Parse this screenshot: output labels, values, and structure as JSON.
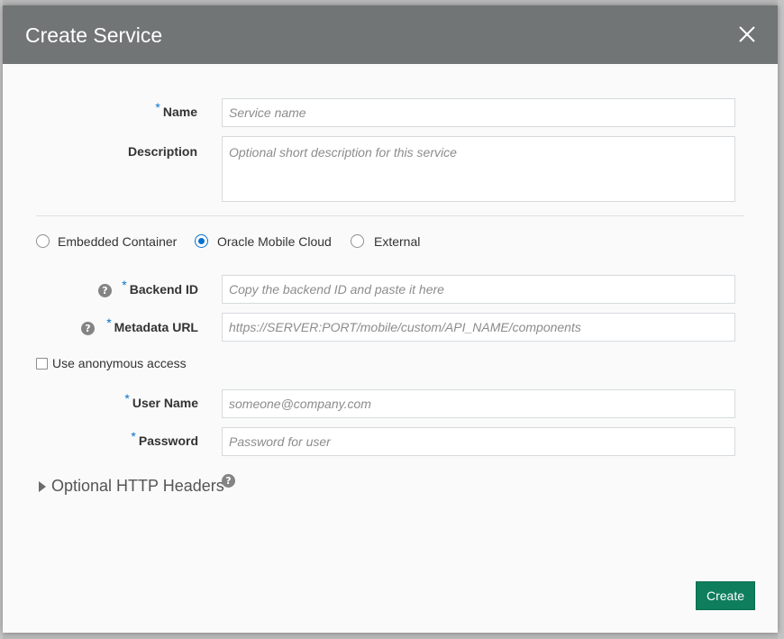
{
  "dialog": {
    "title": "Create Service",
    "close_icon": "close-icon"
  },
  "fields": {
    "name": {
      "label": "Name",
      "required": "*",
      "placeholder": "Service name",
      "value": ""
    },
    "description": {
      "label": "Description",
      "placeholder": "Optional short description for this service",
      "value": ""
    },
    "backend_id": {
      "label": "Backend ID",
      "required": "*",
      "help": "?",
      "placeholder": "Copy the backend ID and paste it here",
      "value": ""
    },
    "metadata_url": {
      "label": "Metadata URL",
      "required": "*",
      "help": "?",
      "placeholder": "https://SERVER:PORT/mobile/custom/API_NAME/components",
      "value": ""
    },
    "user_name": {
      "label": "User Name",
      "required": "*",
      "placeholder": "someone@company.com",
      "value": ""
    },
    "password": {
      "label": "Password",
      "required": "*",
      "placeholder": "Password for user",
      "value": ""
    }
  },
  "service_type": {
    "options": [
      "Embedded Container",
      "Oracle Mobile Cloud",
      "External"
    ],
    "selected": "Oracle Mobile Cloud"
  },
  "anonymous_access": {
    "label": "Use anonymous access",
    "checked": false
  },
  "optional_headers": {
    "label": "Optional HTTP Headers",
    "help": "?",
    "expanded": false
  },
  "actions": {
    "create_label": "Create"
  },
  "colors": {
    "header_bg": "#717576",
    "accent": "#0572ce",
    "create_button": "#0e7e5c",
    "overlay": "#b9b9b9"
  }
}
